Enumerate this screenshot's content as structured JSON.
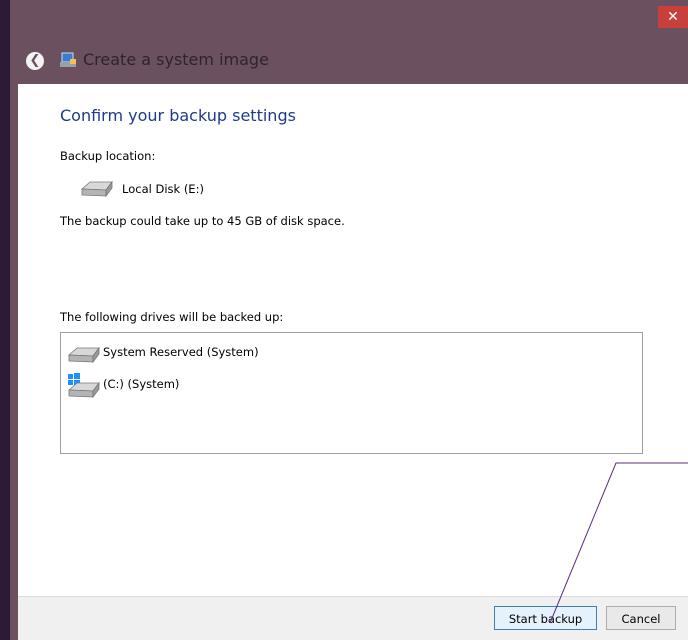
{
  "window": {
    "title": "Create a system image",
    "close_label": "✕",
    "back_label": "❮"
  },
  "main": {
    "heading": "Confirm your backup settings",
    "backup_location_label": "Backup location:",
    "location_name": "Local Disk (E:)",
    "space_note": "The backup could take up to 45 GB of disk space.",
    "drives_label": "The following drives will be backed up:",
    "drives": [
      {
        "name": "System Reserved (System)",
        "icon": "hard-drive-icon"
      },
      {
        "name": "(C:) (System)",
        "icon": "windows-drive-icon"
      }
    ]
  },
  "footer": {
    "start_label": "Start backup",
    "cancel_label": "Cancel"
  },
  "colors": {
    "titlebar": "#6b5060",
    "close": "#c7403c",
    "heading": "#1e3a8a"
  }
}
